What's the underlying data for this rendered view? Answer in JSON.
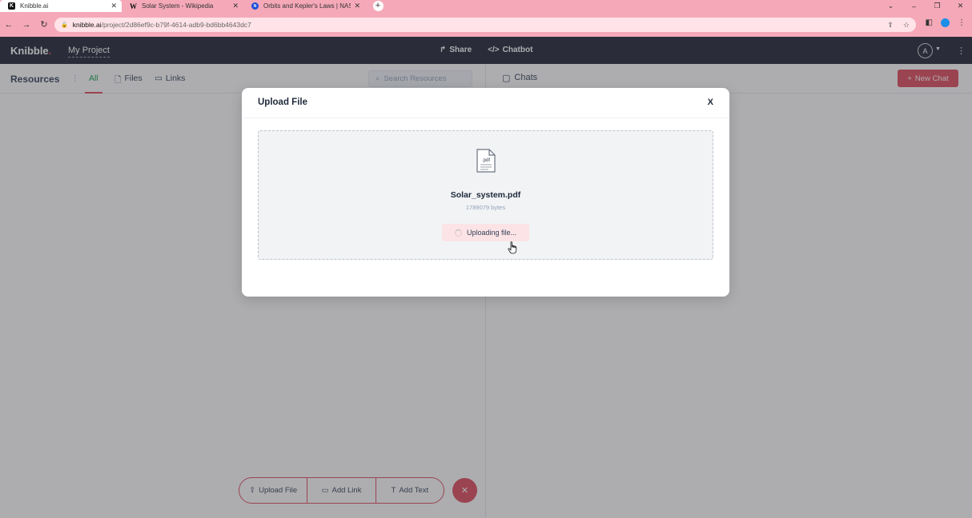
{
  "browser": {
    "tabs": [
      {
        "title": "Knibble.ai",
        "favicon": "K",
        "active": true
      },
      {
        "title": "Solar System - Wikipedia",
        "favicon": "W",
        "active": false
      },
      {
        "title": "Orbits and Kepler's Laws | NAS",
        "favicon": "N",
        "active": false
      }
    ],
    "url_host": "knibble.ai",
    "url_path": "/project/2d86ef9c-b79f-4614-adb9-bd6bb4643dc7"
  },
  "header": {
    "logo": "Knibble",
    "project_name": "My Project",
    "share_label": "Share",
    "chatbot_label": "Chatbot",
    "avatar_letter": "A"
  },
  "resources": {
    "title": "Resources",
    "tabs": {
      "all": "All",
      "files": "Files",
      "links": "Links"
    },
    "search_placeholder": "Search Resources"
  },
  "chats": {
    "title": "Chats",
    "new_chat_label": "New Chat"
  },
  "actions": {
    "upload_file": "Upload File",
    "add_link": "Add Link",
    "add_text": "Add Text",
    "close_symbol": "✕"
  },
  "modal": {
    "title": "Upload File",
    "close_label": "X",
    "file_ext": ".pdf",
    "file_name": "Solar_system.pdf",
    "file_size": "1789079 bytes",
    "status": "Uploading file..."
  },
  "colors": {
    "accent": "#e04a5c",
    "header_bg": "#1e2433",
    "browser_chrome": "#f5a9b8"
  }
}
